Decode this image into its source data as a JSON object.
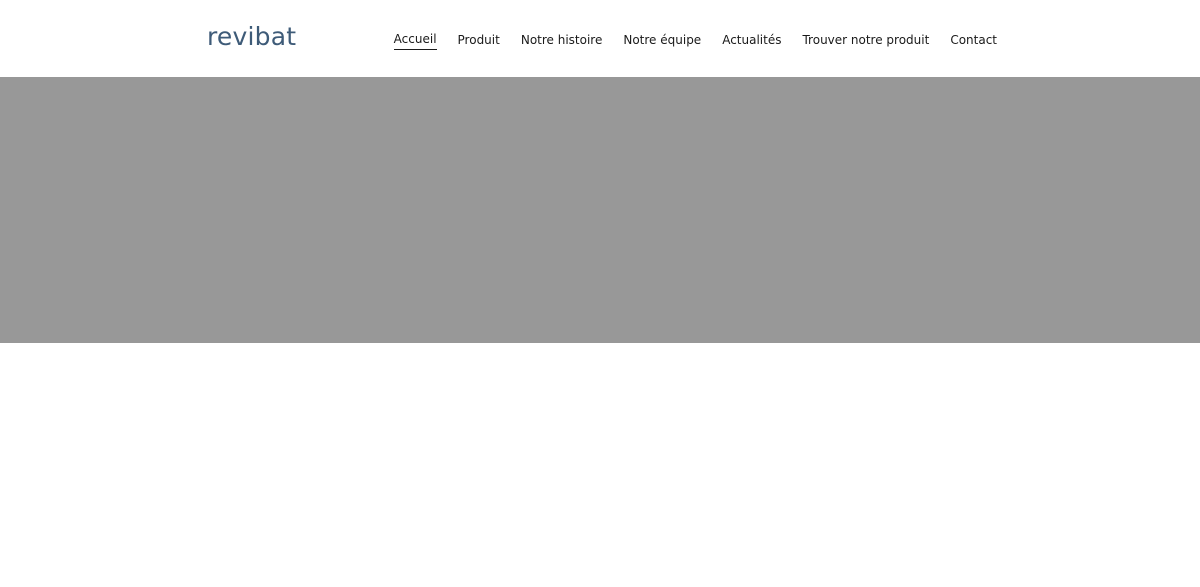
{
  "header": {
    "logo_text": "revibat",
    "nav": [
      {
        "label": "Accueil",
        "active": true
      },
      {
        "label": "Produit",
        "active": false
      },
      {
        "label": "Notre histoire",
        "active": false
      },
      {
        "label": "Notre équipe",
        "active": false
      },
      {
        "label": "Actualités",
        "active": false
      },
      {
        "label": "Trouver notre produit",
        "active": false
      },
      {
        "label": "Contact",
        "active": false
      }
    ]
  },
  "colors": {
    "brand": "#3e5b78",
    "hero_background": "#989898",
    "text": "#1a1a1a",
    "background": "#ffffff"
  }
}
